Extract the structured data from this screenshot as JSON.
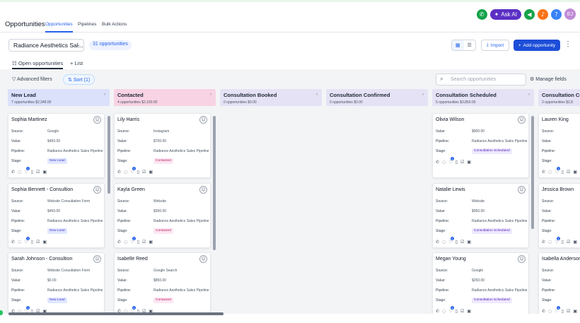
{
  "header": {
    "ask_ai_label": "Ask AI",
    "avatar_initials": "EJ",
    "icons": [
      "phone-icon",
      "sparkle-icon",
      "megaphone-icon",
      "bell-icon",
      "help-icon"
    ],
    "colors": {
      "phone": "#16a34a",
      "ask_ai": "#5b2fc4",
      "megaphone": "#16a34a",
      "bell": "#f97316",
      "help": "#3b82f6",
      "avatar": "#c08bd6"
    }
  },
  "nav": {
    "title": "Opportunities",
    "tabs": [
      {
        "label": "Opportunities",
        "active": true
      },
      {
        "label": "Pipelines",
        "active": false
      },
      {
        "label": "Bulk Actions",
        "active": false
      }
    ]
  },
  "toolbar": {
    "pipeline": "Radiance Aesthetics Sal...",
    "count": "31 opportunities",
    "import_label": "Import",
    "add_label": "Add opportunity"
  },
  "views": {
    "tabs": [
      "Open opportunities",
      "List"
    ]
  },
  "filters": {
    "advanced_label": "Advanced filters",
    "sort_label": "Sort (1)",
    "search_placeholder": "Search opportunities",
    "manage_label": "Manage fields"
  },
  "labels": {
    "source": "Source:",
    "value": "Value:",
    "pipeline": "Pipeline:",
    "stage": "Stage:"
  },
  "columns": [
    {
      "name": "New Lead",
      "meta": "7 opportunities  $2,348.00",
      "color": "#dbe0fb",
      "cards": [
        {
          "name": "Sophia Martinez",
          "source": "Google",
          "value": "$450.00",
          "pipeline": "Radiance Aesthetics Sales Pipeline",
          "stage": "New Lead"
        },
        {
          "name": "Sophia Bennett - Consultion",
          "source": "Website Consultation Form",
          "value": "$450.00",
          "pipeline": "Radiance Aesthetics Sales Pipeline",
          "stage": "New Lead"
        },
        {
          "name": "Sarah Johnson - Consultion",
          "source": "Website Consultation Form",
          "value": "$0.00",
          "pipeline": "Radiance Aesthetics Sales Pipeline",
          "stage": "New Lead"
        }
      ]
    },
    {
      "name": "Contacted",
      "meta": "4 opportunities  $2,100.00",
      "color": "#f8d3e4",
      "cards": [
        {
          "name": "Lily Harris",
          "source": "Instagram",
          "value": "$700.00",
          "pipeline": "Radiance Aesthetics Sales Pipeline",
          "stage": "Contacted"
        },
        {
          "name": "Kayla Green",
          "source": "Website",
          "value": "$300.00",
          "pipeline": "Radiance Aesthetics Sales Pipeline",
          "stage": "Contacted"
        },
        {
          "name": "Isabelle Reed",
          "source": "Google Search",
          "value": "$850.00",
          "pipeline": "Radiance Aesthetics Sales Pipeline",
          "stage": "Contacted"
        }
      ]
    },
    {
      "name": "Consultation Booked",
      "meta": "0 opportunities  $0.00",
      "color": "#e6e2f5",
      "cards": []
    },
    {
      "name": "Consultation Confirmed",
      "meta": "0 opportunities  $0.00",
      "color": "#e6e2f5",
      "cards": []
    },
    {
      "name": "Consultation Scheduled",
      "meta": "5 opportunities  $3,850.00",
      "color": "#e6e2f5",
      "cards": [
        {
          "name": "Olivia Wilson",
          "value": "$900.00",
          "pipeline": "Radiance Aesthetics Sales Pipeline",
          "stage": "Consultation Scheduled"
        },
        {
          "name": "Natalie Lewis",
          "source": "Website",
          "value": "$950.00",
          "pipeline": "Radiance Aesthetics Sales Pipeline",
          "stage": "Consultation Scheduled"
        },
        {
          "name": "Megan Young",
          "source": "Google",
          "value": "$250.00",
          "pipeline": "Radiance Aesthetics Sales Pipeline",
          "stage": "Consultation Scheduled"
        }
      ]
    },
    {
      "name": "Consultation Completed",
      "meta": "3 opportunities  $2,8",
      "color": "#e6e2f5",
      "cards": [
        {
          "name": "Lauren King"
        },
        {
          "name": "Jessica Brown"
        },
        {
          "name": "Isabella Anderson"
        }
      ]
    }
  ]
}
